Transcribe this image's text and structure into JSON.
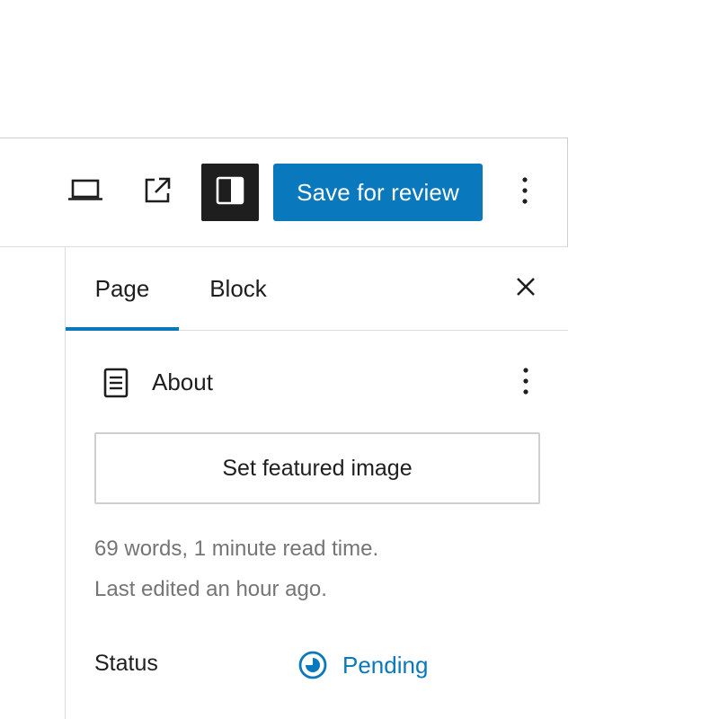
{
  "toolbar": {
    "preview_icon": "laptop-icon",
    "view_icon": "external-link-icon",
    "settings_icon": "sidebar-panel-icon",
    "save_label": "Save for review",
    "more_icon": "vertical-ellipsis-icon",
    "accent_color": "#0a78bd"
  },
  "sidebar": {
    "tabs": [
      {
        "label": "Page",
        "active": true
      },
      {
        "label": "Block",
        "active": false
      }
    ],
    "close_icon": "close-icon",
    "document": {
      "icon": "page-document-icon",
      "title": "About",
      "more_icon": "vertical-ellipsis-icon"
    },
    "featured_image_button": "Set featured image",
    "meta": {
      "words": "69 words, 1 minute read time.",
      "last_edited": "Last edited an hour ago."
    },
    "status": {
      "label": "Status",
      "value": "Pending",
      "icon": "pending-status-icon"
    }
  }
}
